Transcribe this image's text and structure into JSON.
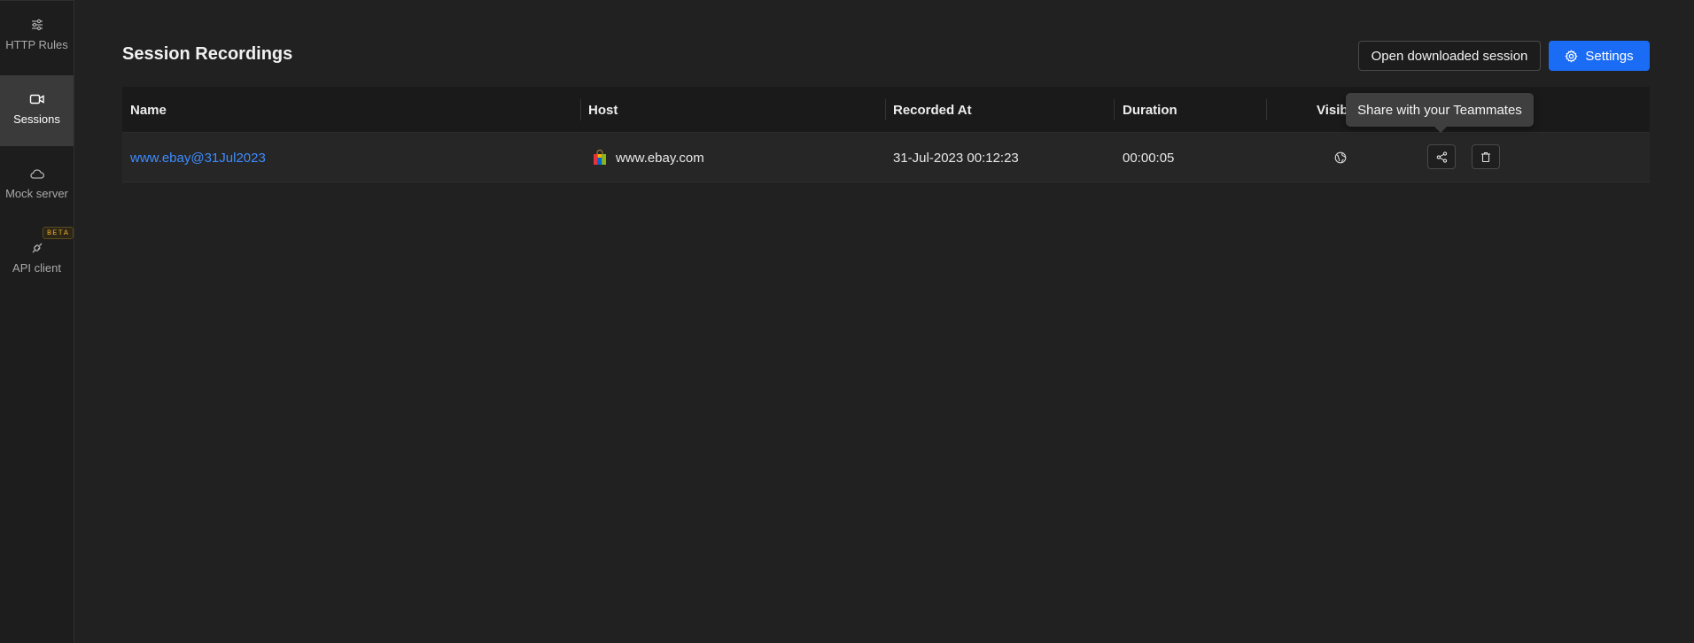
{
  "sidebar": {
    "items": [
      {
        "label": "HTTP Rules",
        "icon": "sliders-icon",
        "active": false
      },
      {
        "label": "Sessions",
        "icon": "video-camera-icon",
        "active": true
      },
      {
        "label": "Mock server",
        "icon": "cloud-icon",
        "active": false
      },
      {
        "label": "API client",
        "icon": "plug-icon",
        "active": false,
        "badge": "BETA"
      }
    ]
  },
  "header": {
    "title": "Session Recordings",
    "open_session_label": "Open downloaded session",
    "settings_label": "Settings"
  },
  "table": {
    "columns": [
      "Name",
      "Host",
      "Recorded At",
      "Duration",
      "Visib"
    ],
    "rows": [
      {
        "name": "www.ebay@31Jul2023",
        "host": "www.ebay.com",
        "recorded_at": "31-Jul-2023 00:12:23",
        "duration": "00:00:05",
        "visibility_icon": "globe-icon"
      }
    ]
  },
  "tooltip": {
    "text": "Share with your Teammates"
  },
  "colors": {
    "accent": "#1b6cf5",
    "link": "#3e8cff",
    "beta": "#e3a72f"
  }
}
